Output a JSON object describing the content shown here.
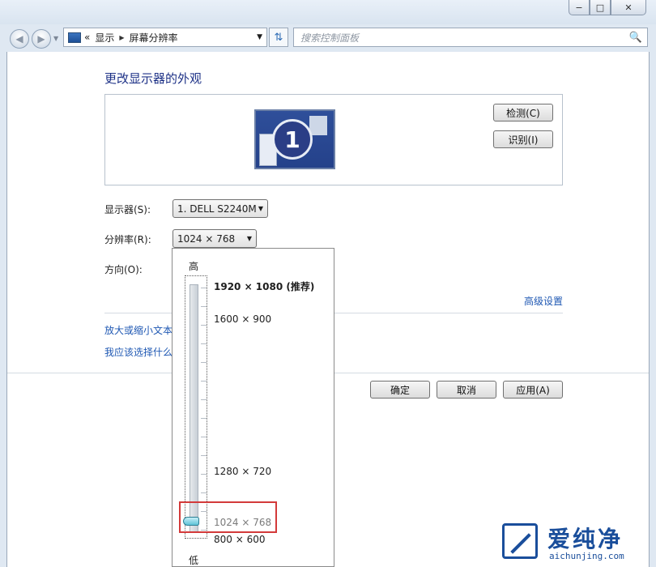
{
  "window": {
    "minimize": "−",
    "maximize": "□",
    "close": "✕"
  },
  "address": {
    "chevrons": "«",
    "path1": "显示",
    "path2": "屏幕分辨率",
    "separator": "▶",
    "dropdown": "▼"
  },
  "search": {
    "placeholder": "搜索控制面板",
    "icon": "🔍"
  },
  "page": {
    "heading": "更改显示器的外观",
    "monitor_number": "1",
    "detect_label": "检测(C)",
    "identify_label": "识别(I)",
    "display_label": "显示器(S):",
    "display_value": "1. DELL S2240M",
    "resolution_label": "分辨率(R):",
    "resolution_value": "1024 × 768",
    "orientation_label": "方向(O):",
    "advanced_link": "高级设置",
    "link_text_size": "放大或缩小文本",
    "link_which": "我应该选择什么",
    "ok_label": "确定",
    "cancel_label": "取消",
    "apply_label": "应用(A)"
  },
  "popup": {
    "high_label": "高",
    "low_label": "低",
    "options": [
      "1920 × 1080 (推荐)",
      "1600 × 900",
      "1280 × 720",
      "1024 × 768",
      "800 × 600"
    ],
    "selected_index": 3
  },
  "watermark": {
    "cn": "爱纯净",
    "en": "aichunjing.com"
  },
  "colors": {
    "link": "#1f58b3",
    "heading": "#1e3287",
    "highlight_box": "#d33a3a"
  }
}
